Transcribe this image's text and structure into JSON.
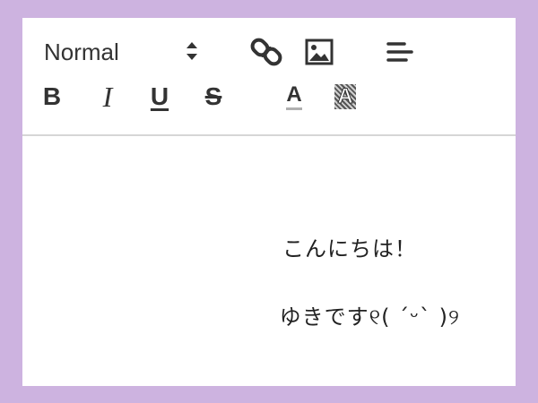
{
  "toolbar": {
    "heading_select": {
      "value": "Normal"
    },
    "buttons": {
      "bold": "B",
      "italic": "I",
      "underline": "U",
      "strike": "S",
      "color": "A",
      "background": "A"
    },
    "icons": [
      "chevron-updown-icon",
      "link-icon",
      "image-icon",
      "align-left-icon"
    ]
  },
  "editor": {
    "lines": [
      "こんにちは！",
      "ゆきです୧( ˊᵕˋ )୨"
    ]
  },
  "colors": {
    "frame": "#cdb3e0",
    "text": "#333333",
    "divider": "#d6d6d6"
  }
}
